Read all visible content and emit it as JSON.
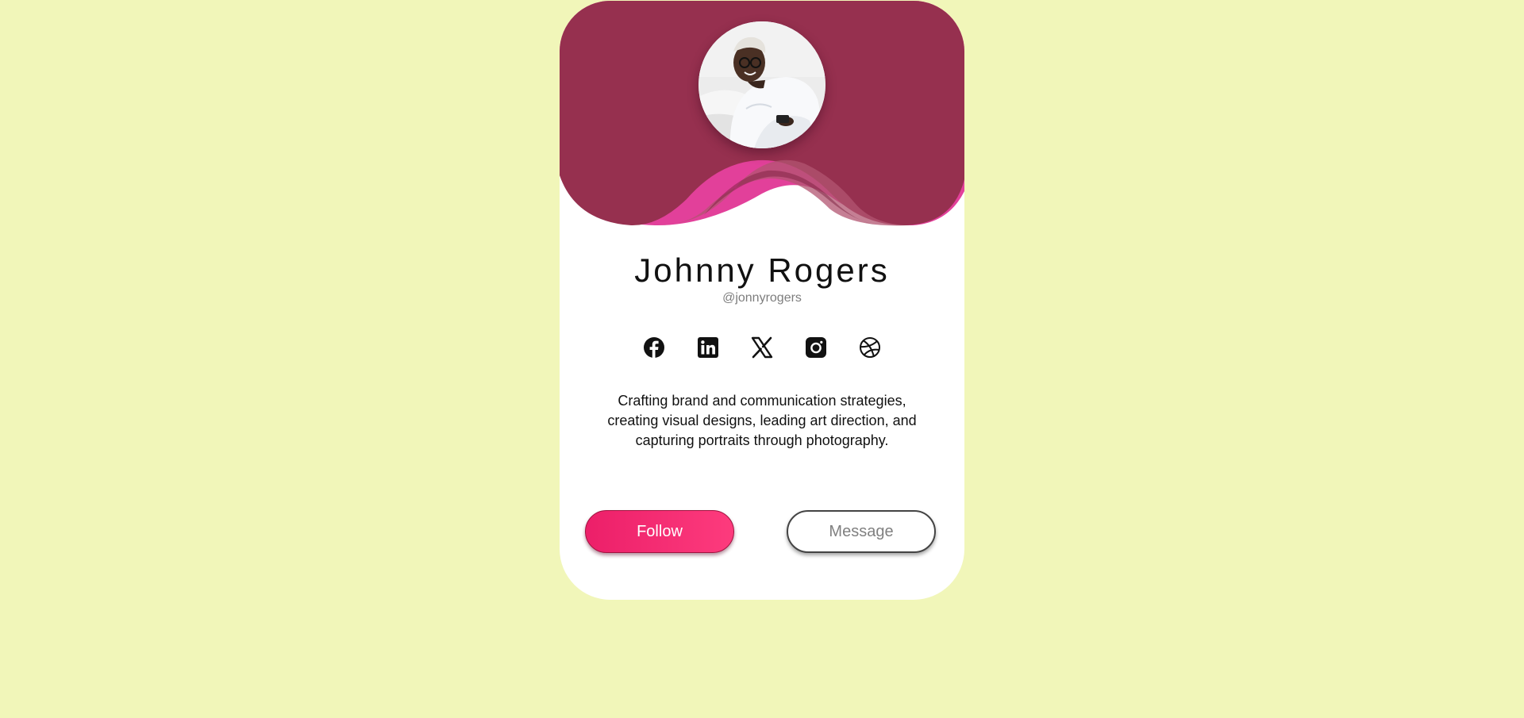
{
  "profile": {
    "name": "Johnny Rogers",
    "handle": "@jonnyrogers",
    "bio": "Crafting brand and communication strategies, creating visual designs, leading art direction, and capturing portraits through photography."
  },
  "socials": [
    {
      "icon": "facebook-icon"
    },
    {
      "icon": "linkedin-icon"
    },
    {
      "icon": "x-icon"
    },
    {
      "icon": "instagram-icon"
    },
    {
      "icon": "dribbble-icon"
    }
  ],
  "actions": {
    "follow_label": "Follow",
    "message_label": "Message"
  },
  "colors": {
    "page_background": "#f1f6b9",
    "header": "#96304f",
    "wave_accent": "#e2409a",
    "follow_gradient_start": "#ec1f69",
    "follow_gradient_end": "#fd3b7d"
  }
}
